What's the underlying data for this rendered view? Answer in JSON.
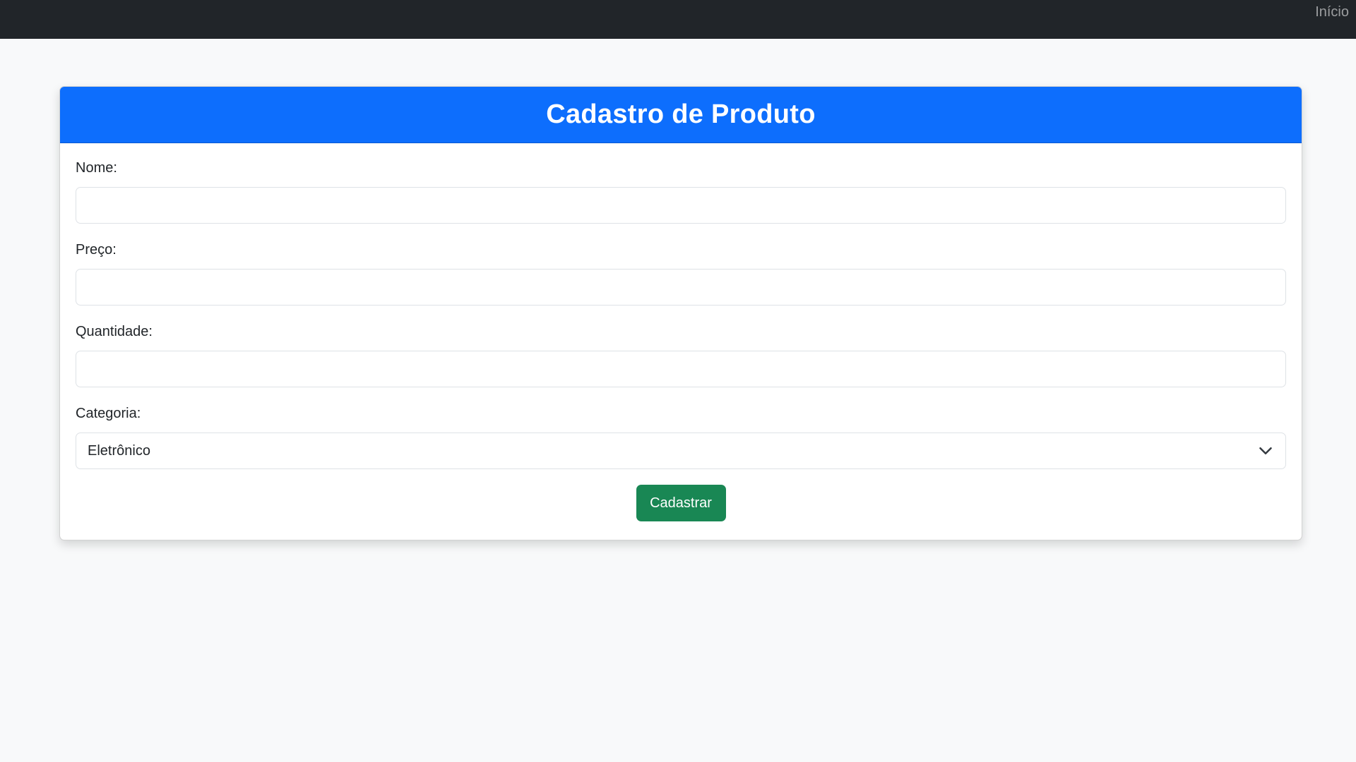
{
  "navbar": {
    "home_link": "Início"
  },
  "card": {
    "title": "Cadastro de Produto"
  },
  "form": {
    "name": {
      "label": "Nome:",
      "value": ""
    },
    "price": {
      "label": "Preço:",
      "value": ""
    },
    "quantity": {
      "label": "Quantidade:",
      "value": ""
    },
    "category": {
      "label": "Categoria:",
      "selected": "Eletrônico"
    },
    "submit_label": "Cadastrar"
  },
  "colors": {
    "navbar": "#212529",
    "header": "#0d6efd",
    "submit": "#198754",
    "background": "#f8f9fa"
  },
  "icons": {
    "select_arrow": "chevron-down-icon"
  }
}
